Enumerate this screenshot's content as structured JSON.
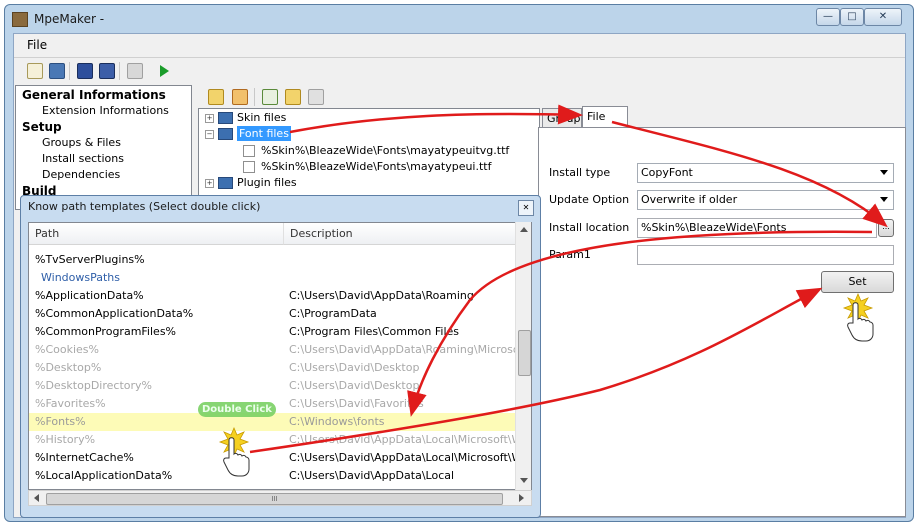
{
  "window": {
    "title": "MpeMaker -",
    "controls": {
      "minimize": "—",
      "maximize": "□",
      "close": "✕"
    }
  },
  "menubar": {
    "file": "File"
  },
  "toolbar_icons": [
    "new-icon",
    "open-icon",
    "save-icon",
    "save-as-icon",
    "copy-icon",
    "run-icon"
  ],
  "nav": {
    "items": [
      {
        "label": "General Informations",
        "bold": true
      },
      {
        "label": "Extension Informations",
        "bold": false
      },
      {
        "label": "Setup",
        "bold": true
      },
      {
        "label": "Groups & Files",
        "bold": false,
        "selected": true
      },
      {
        "label": "Install sections",
        "bold": false
      },
      {
        "label": "Dependencies",
        "bold": false
      },
      {
        "label": "Build",
        "bold": true
      }
    ]
  },
  "files_toolbar_icons": [
    "add-folder-icon",
    "remove-folder-icon",
    "add-file-icon",
    "add-folder-files-icon",
    "remove-file-icon"
  ],
  "tree": {
    "skin_files": "Skin files",
    "font_files": "Font files",
    "font_file_1": "%Skin%\\BleazeWide\\Fonts\\mayatypeuitvg.ttf",
    "font_file_2": "%Skin%\\BleazeWide\\Fonts\\mayatypeui.ttf",
    "plugin_files": "Plugin files"
  },
  "tabs": {
    "group": "Group",
    "file": "File"
  },
  "file_props": {
    "install_type_label": "Install type",
    "install_type_value": "CopyFont",
    "update_option_label": "Update Option",
    "update_option_value": "Overwrite if older",
    "install_location_label": "Install location",
    "install_location_value": "%Skin%\\BleazeWide\\Fonts",
    "browse": "...",
    "param1_label": "Param1",
    "param1_value": "",
    "set_button": "Set"
  },
  "dialog": {
    "title": "Know path templates (Select double click)",
    "close": "✕",
    "col_path": "Path",
    "col_description": "Description",
    "rows": [
      {
        "path": "%TvServerPlugins%",
        "desc": "",
        "style": ""
      },
      {
        "path": "WindowsPaths",
        "desc": "",
        "style": "grp"
      },
      {
        "path": "%ApplicationData%",
        "desc": "C:\\Users\\David\\AppData\\Roaming",
        "style": ""
      },
      {
        "path": "%CommonApplicationData%",
        "desc": "C:\\ProgramData",
        "style": ""
      },
      {
        "path": "%CommonProgramFiles%",
        "desc": "C:\\Program Files\\Common Files",
        "style": ""
      },
      {
        "path": "%Cookies%",
        "desc": "C:\\Users\\David\\AppData\\Roaming\\Microsoft\\",
        "style": "faded"
      },
      {
        "path": "%Desktop%",
        "desc": "C:\\Users\\David\\Desktop",
        "style": "faded"
      },
      {
        "path": "%DesktopDirectory%",
        "desc": "C:\\Users\\David\\Desktop",
        "style": "faded"
      },
      {
        "path": "%Favorites%",
        "desc": "C:\\Users\\David\\Favorites",
        "style": "faded"
      },
      {
        "path": "%Fonts%",
        "desc": "C:\\Windows\\fonts",
        "style": "hl"
      },
      {
        "path": "%History%",
        "desc": "C:\\Users\\David\\AppData\\Local\\Microsoft\\Win",
        "style": "faded"
      },
      {
        "path": "%InternetCache%",
        "desc": "C:\\Users\\David\\AppData\\Local\\Microsoft\\Win",
        "style": ""
      },
      {
        "path": "%LocalApplicationData%",
        "desc": "C:\\Users\\David\\AppData\\Local",
        "style": ""
      }
    ],
    "hscroll_thumb": "III"
  },
  "annotation": {
    "double_click": "Double Click"
  },
  "colors": {
    "arrow": "#e01b1b",
    "selection": "#3399ff",
    "highlight_row": "#fdfbb7"
  }
}
